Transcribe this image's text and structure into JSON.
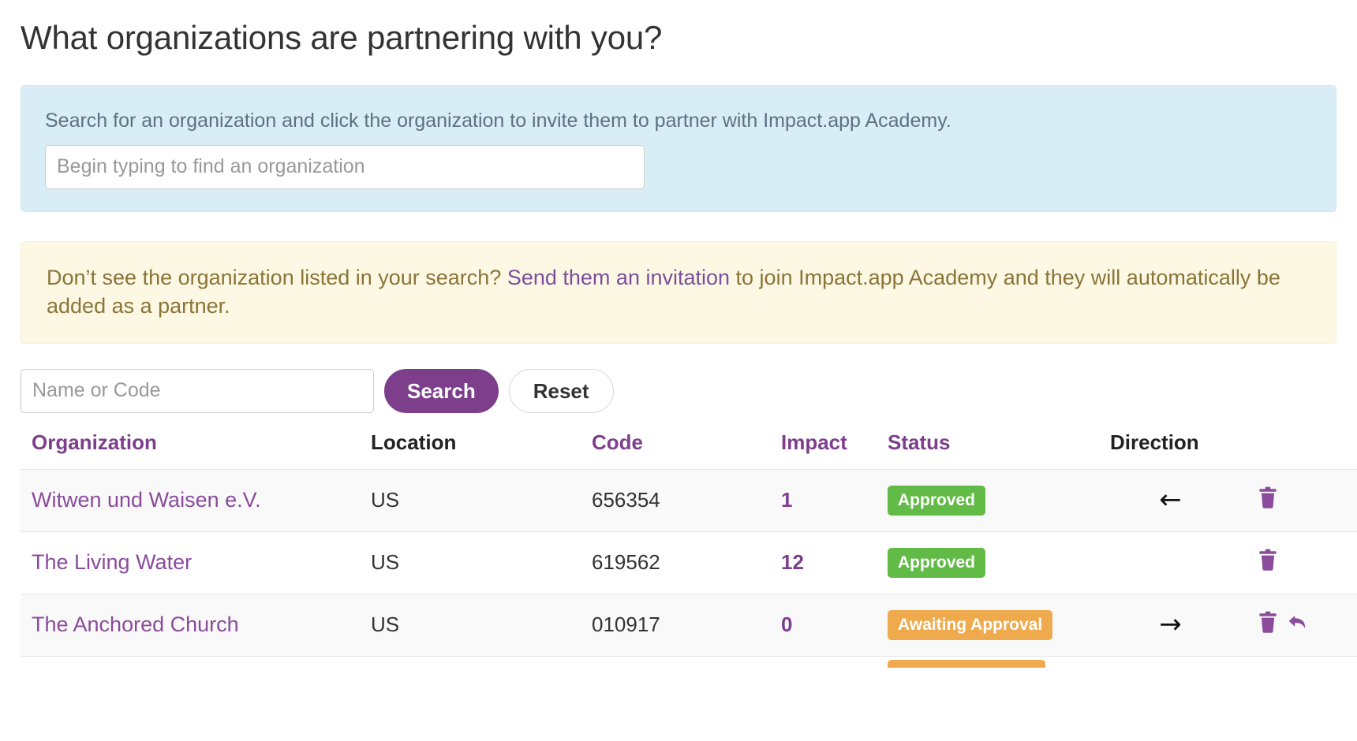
{
  "page": {
    "title": "What organizations are partnering with you?"
  },
  "info_panel": {
    "text": "Search for an organization and click the organization to invite them to partner with Impact.app Academy.",
    "search_placeholder": "Begin typing to find an organization",
    "search_value": "",
    "background_color": "#d9edf7"
  },
  "warning_panel": {
    "text_before": "Don’t see the organization listed in your search? ",
    "link_text": "Send them an invitation",
    "text_after": " to join Impact.app Academy and they will automatically be added as a partner.",
    "background_color": "#fcf8e3",
    "text_color": "#8a7438",
    "link_color": "#7b4f9d"
  },
  "filter": {
    "placeholder": "Name or Code",
    "value": "",
    "search_label": "Search",
    "reset_label": "Reset",
    "search_color": "#7d3f8c"
  },
  "table": {
    "headers": [
      {
        "label": "Organization",
        "sortable": true
      },
      {
        "label": "Location",
        "sortable": false
      },
      {
        "label": "Code",
        "sortable": true
      },
      {
        "label": "Impact",
        "sortable": true
      },
      {
        "label": "Status",
        "sortable": true
      },
      {
        "label": "Direction",
        "sortable": false
      },
      {
        "label": "",
        "sortable": false
      }
    ],
    "rows": [
      {
        "organization": "Witwen und Waisen e.V.",
        "location": "US",
        "code": "656354",
        "impact": "1",
        "status": "Approved",
        "status_kind": "approved",
        "direction": "←",
        "direction_icon": "arrow-left-icon",
        "actions": [
          "delete-icon"
        ]
      },
      {
        "organization": "The Living Water",
        "location": "US",
        "code": "619562",
        "impact": "12",
        "status": "Approved",
        "status_kind": "approved",
        "direction": "",
        "direction_icon": "",
        "actions": [
          "delete-icon"
        ]
      },
      {
        "organization": "The Anchored Church",
        "location": "US",
        "code": "010917",
        "impact": "0",
        "status": "Awaiting Approval",
        "status_kind": "awaiting",
        "direction": "→",
        "direction_icon": "arrow-right-icon",
        "actions": [
          "delete-icon",
          "undo-icon"
        ]
      }
    ],
    "badge_colors": {
      "approved": "#62bb46",
      "awaiting": "#eeaa4d"
    },
    "link_color": "#8a4b9b"
  }
}
